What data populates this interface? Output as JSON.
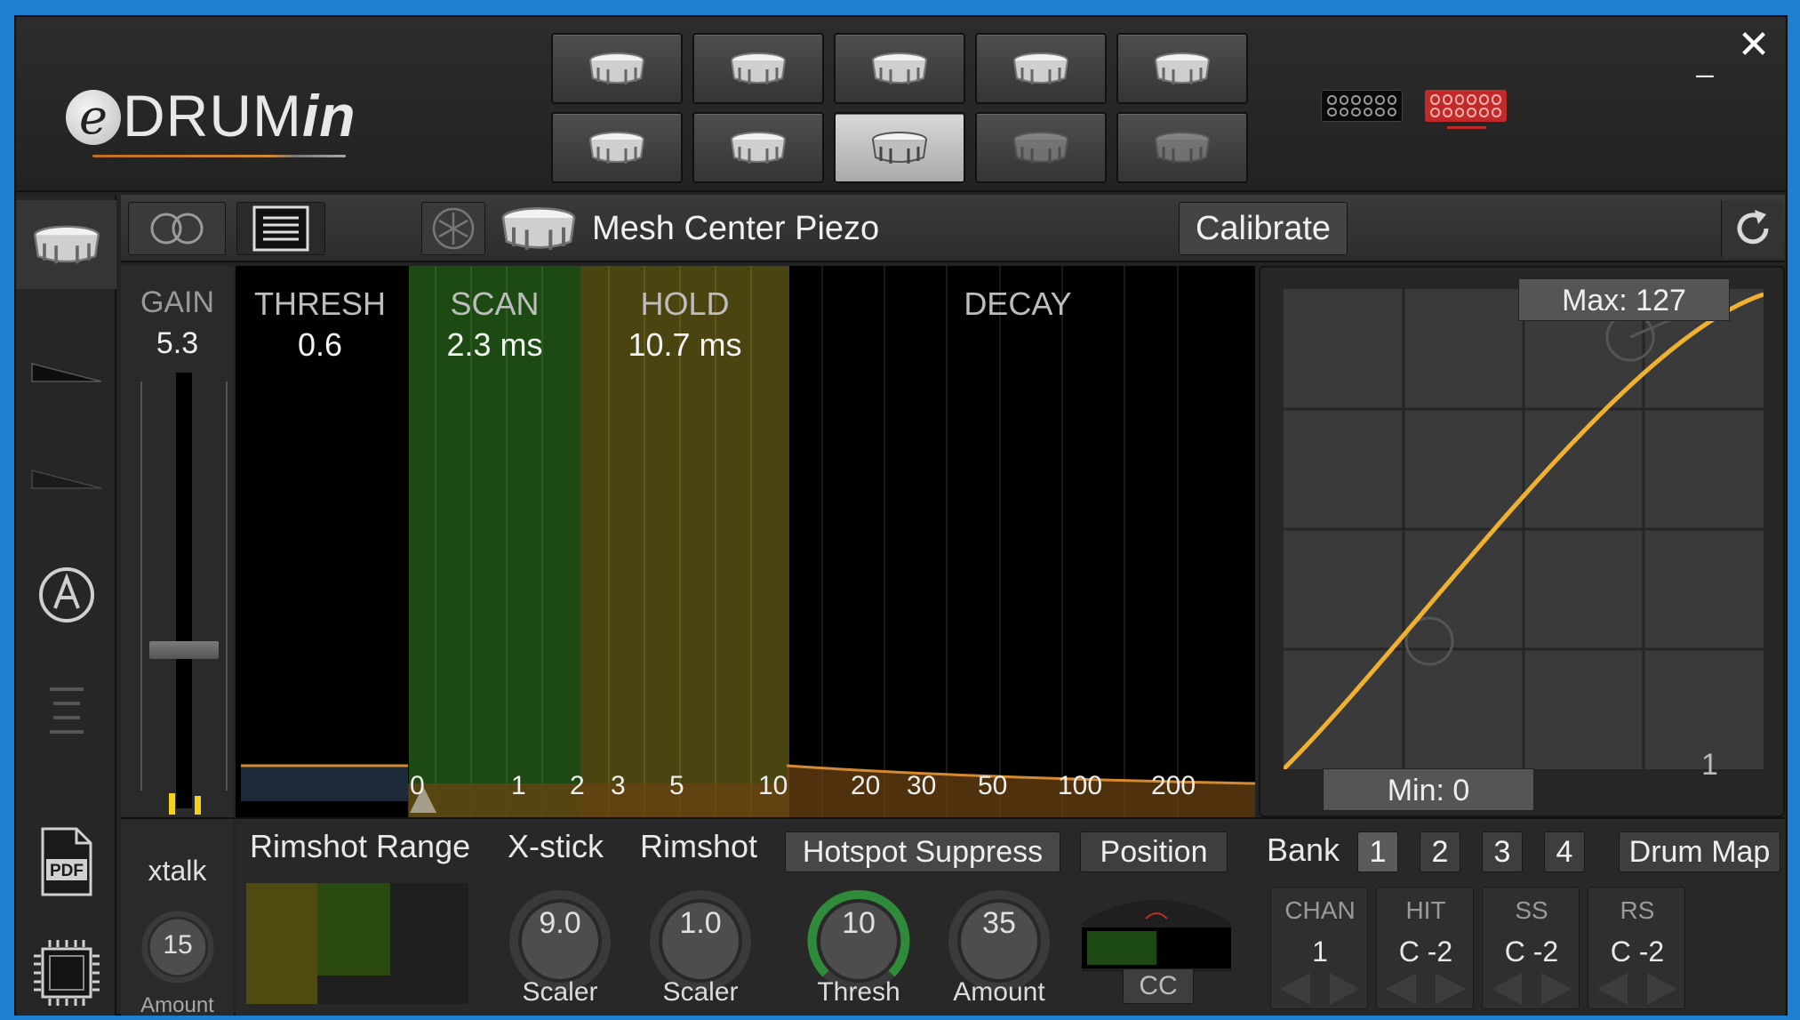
{
  "app": {
    "logo_prefix": "e",
    "logo_main": "DRUM",
    "logo_suffix": "in",
    "minimize_label": "_",
    "close_label": "✕"
  },
  "pads": [
    {
      "state": "normal"
    },
    {
      "state": "normal"
    },
    {
      "state": "normal"
    },
    {
      "state": "normal"
    },
    {
      "state": "normal"
    },
    {
      "state": "normal"
    },
    {
      "state": "normal"
    },
    {
      "state": "active"
    },
    {
      "state": "dim"
    },
    {
      "state": "dim"
    }
  ],
  "toolbar": {
    "pad_name": "Mesh Center Piezo",
    "calibrate_label": "Calibrate"
  },
  "gain": {
    "label": "GAIN",
    "value": "5.3",
    "slider_level": 0.37,
    "meter_levels": [
      0.04,
      0.035
    ]
  },
  "graph": {
    "thresh_label": "THRESH",
    "thresh_value": "0.6",
    "scan_label": "SCAN",
    "scan_value": "2.3 ms",
    "hold_label": "HOLD",
    "hold_value": "10.7 ms",
    "decay_label": "DECAY",
    "axis_ticks": [
      "0",
      "1",
      "2",
      "3",
      "5",
      "10",
      "20",
      "30",
      "50",
      "100",
      "200"
    ]
  },
  "curve": {
    "max_label": "Max: 127",
    "min_label": "Min: 0",
    "curve_id": "1"
  },
  "xtalk": {
    "label": "xtalk",
    "value": "15",
    "sublabel": "Amount"
  },
  "bottom": {
    "rimshot_range_label": "Rimshot Range",
    "xstick_label": "X-stick",
    "xstick_value": "9.0",
    "xstick_sub": "Scaler",
    "rimshot_label": "Rimshot",
    "rimshot_value": "1.0",
    "rimshot_sub": "Scaler",
    "hotspot_label": "Hotspot Suppress",
    "hotspot_thresh_value": "10",
    "hotspot_thresh_sub": "Thresh",
    "hotspot_amount_value": "35",
    "hotspot_amount_sub": "Amount",
    "position_label": "Position",
    "cc_label": "CC",
    "bank_label": "Bank",
    "bank_numbers": [
      "1",
      "2",
      "3",
      "4"
    ],
    "drum_map_label": "Drum Map",
    "midi": [
      {
        "header": "CHAN",
        "value": "1"
      },
      {
        "header": "HIT",
        "value": "C -2"
      },
      {
        "header": "SS",
        "value": "C -2"
      },
      {
        "header": "RS",
        "value": "C -2"
      }
    ]
  },
  "colors": {
    "accent_orange": "#f0b030",
    "scan_green": "#1c4a12",
    "hold_olive": "#4f4a10",
    "port_red": "#c22a2a"
  }
}
